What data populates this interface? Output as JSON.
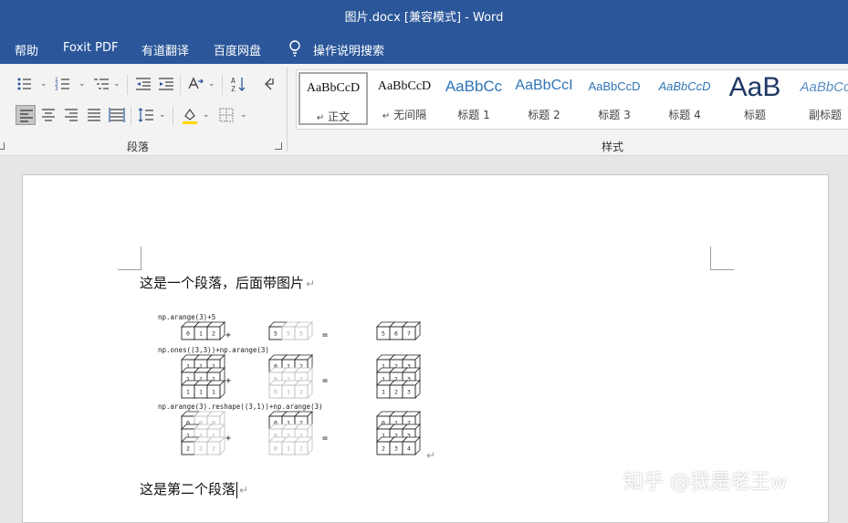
{
  "window": {
    "title": "图片.docx [兼容模式] - Word"
  },
  "menu": {
    "items": [
      {
        "label": "帮助"
      },
      {
        "label": "Foxit PDF"
      },
      {
        "label": "有道翻译"
      },
      {
        "label": "百度网盘"
      }
    ],
    "tell_me": "操作说明搜索"
  },
  "ribbon": {
    "paragraph_group": "段落",
    "styles_group": "样式",
    "styles": [
      {
        "preview": "AaBbCcD",
        "name": "正文",
        "mark": "↵"
      },
      {
        "preview": "AaBbCcD",
        "name": "无间隔",
        "mark": "↵"
      },
      {
        "preview": "AaBbCc",
        "name": "标题 1"
      },
      {
        "preview": "AaBbCcI",
        "name": "标题 2"
      },
      {
        "preview": "AaBbCcD",
        "name": "标题 3"
      },
      {
        "preview": "AaBbCcD",
        "name": "标题 4"
      },
      {
        "preview": "AaB",
        "name": "标题"
      },
      {
        "preview": "AaBbCc",
        "name": "副标题"
      }
    ]
  },
  "document": {
    "paragraph1": "这是一个段落，后面带图片",
    "paragraph2": "这是第二个段落",
    "paragraph_mark": "↵"
  },
  "figure": {
    "captions": [
      "np.arange(3)+5",
      "np.ones((3,3))+np.arange(3)",
      "np.arange(3).reshape((3,1))+np.arange(3)"
    ],
    "plus": "+",
    "equals": "=",
    "row1": {
      "left": [
        "0",
        "1",
        "2"
      ],
      "right": [
        "5",
        "5",
        "5"
      ],
      "result": [
        "5",
        "6",
        "7"
      ]
    },
    "row2": {
      "left": [
        [
          "1",
          "1",
          "1"
        ],
        [
          "1",
          "1",
          "1"
        ],
        [
          "1",
          "1",
          "1"
        ]
      ],
      "right": [
        [
          "0",
          "1",
          "2"
        ],
        [
          "0",
          "1",
          "2"
        ],
        [
          "0",
          "1",
          "2"
        ]
      ],
      "result": [
        [
          "1",
          "2",
          "3"
        ],
        [
          "1",
          "2",
          "3"
        ],
        [
          "1",
          "2",
          "3"
        ]
      ]
    },
    "row3": {
      "left": [
        [
          "0",
          "0",
          "0"
        ],
        [
          "1",
          "1",
          "1"
        ],
        [
          "2",
          "2",
          "2"
        ]
      ],
      "right": [
        [
          "0",
          "1",
          "2"
        ],
        [
          "0",
          "1",
          "2"
        ],
        [
          "0",
          "1",
          "2"
        ]
      ],
      "result": [
        [
          "0",
          "1",
          "2"
        ],
        [
          "1",
          "2",
          "3"
        ],
        [
          "2",
          "3",
          "4"
        ]
      ]
    }
  },
  "watermark": "知乎 @我是老王w",
  "colors": {
    "brand": "#2b579a",
    "heading": "#2e74b5",
    "title_dark": "#1f3864"
  }
}
